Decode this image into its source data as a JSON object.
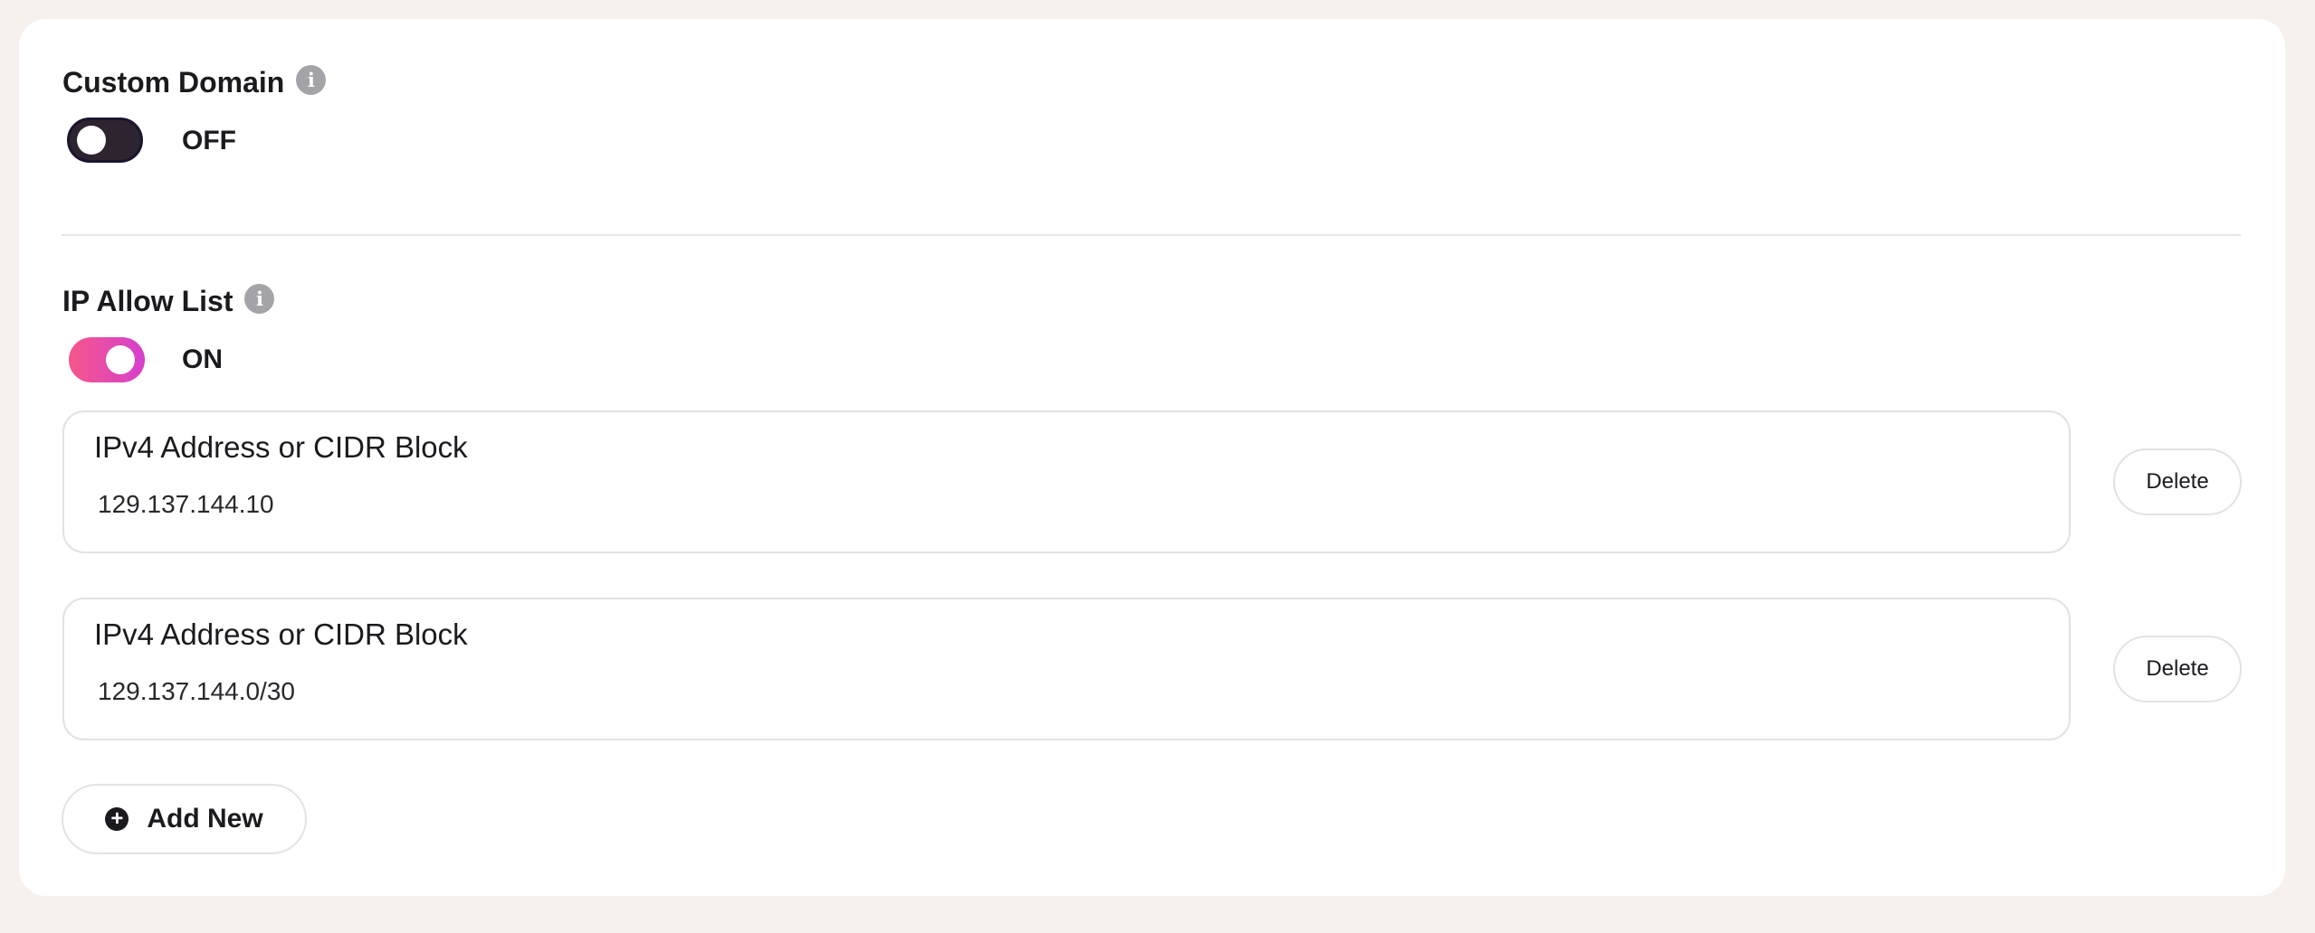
{
  "custom_domain": {
    "title": "Custom Domain",
    "info_icon": "info-icon",
    "toggle_state": "OFF"
  },
  "ip_allow_list": {
    "title": "IP Allow List",
    "info_icon": "info-icon",
    "toggle_state": "ON",
    "entries": [
      {
        "label": "IPv4 Address or CIDR Block",
        "value": "129.137.144.10",
        "delete_label": "Delete"
      },
      {
        "label": "IPv4 Address or CIDR Block",
        "value": "129.137.144.0/30",
        "delete_label": "Delete"
      }
    ],
    "add_new_label": "Add New",
    "add_icon": "plus-circle-icon"
  },
  "colors": {
    "page_background": "#f6f1ed",
    "card_background": "#ffffff",
    "toggle_off": "#2d2430",
    "toggle_on_start": "#f5578a",
    "toggle_on_end": "#d640cc",
    "info_icon": "#a4a3a8"
  }
}
